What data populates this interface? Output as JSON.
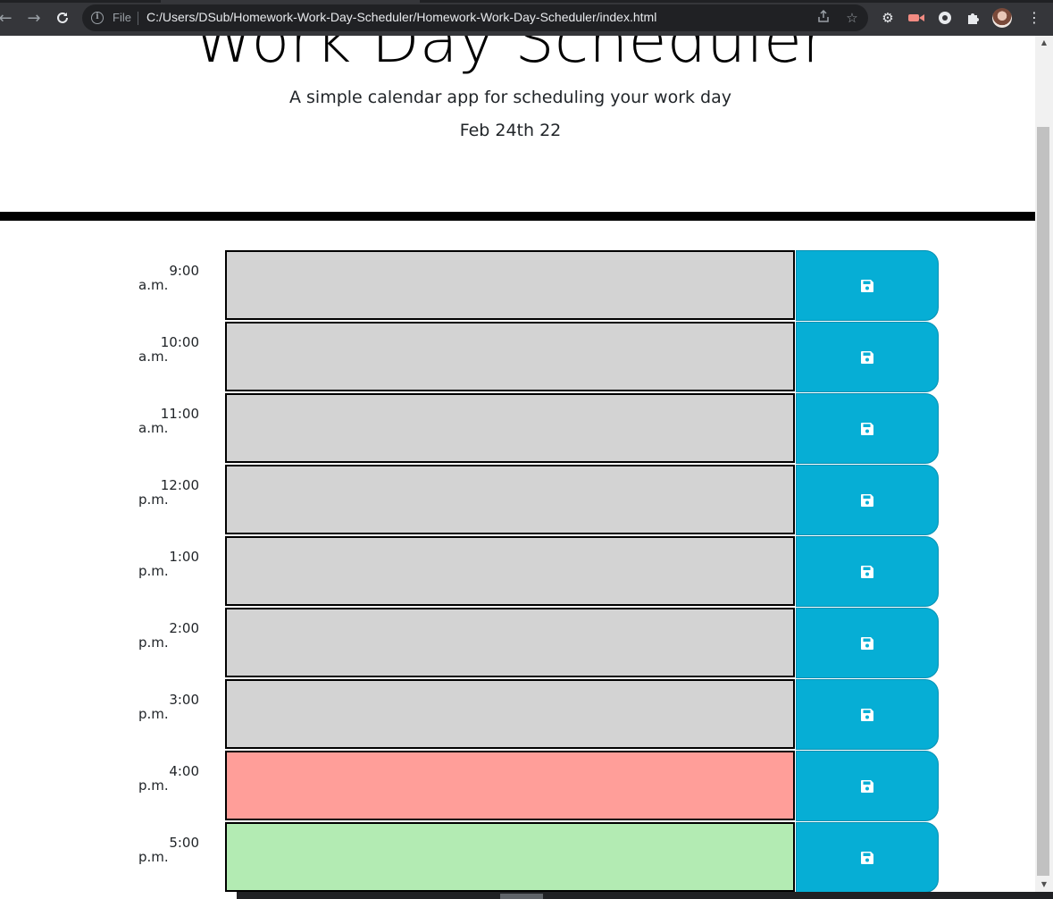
{
  "browser": {
    "file_label": "File",
    "url": "C:/Users/DSub/Homework-Work-Day-Scheduler/Homework-Work-Day-Scheduler/index.html"
  },
  "header": {
    "title": "Work Day Scheduler",
    "subtitle": "A simple calendar app for scheduling your work day",
    "current_day": "Feb 24th 22"
  },
  "colors": {
    "past": "#d3d3d3",
    "present": "#ff9e99",
    "future": "#b3ebb3",
    "save_button": "#06aed5"
  },
  "time_blocks": [
    {
      "time": "9:00",
      "meridiem": "a.m.",
      "status": "past",
      "text": ""
    },
    {
      "time": "10:00",
      "meridiem": "a.m.",
      "status": "past",
      "text": ""
    },
    {
      "time": "11:00",
      "meridiem": "a.m.",
      "status": "past",
      "text": ""
    },
    {
      "time": "12:00",
      "meridiem": "p.m.",
      "status": "past",
      "text": ""
    },
    {
      "time": "1:00",
      "meridiem": "p.m.",
      "status": "past",
      "text": ""
    },
    {
      "time": "2:00",
      "meridiem": "p.m.",
      "status": "past",
      "text": ""
    },
    {
      "time": "3:00",
      "meridiem": "p.m.",
      "status": "past",
      "text": ""
    },
    {
      "time": "4:00",
      "meridiem": "p.m.",
      "status": "present",
      "text": ""
    },
    {
      "time": "5:00",
      "meridiem": "p.m.",
      "status": "future",
      "text": ""
    }
  ],
  "icons": {
    "save": "floppy-disk-icon"
  }
}
